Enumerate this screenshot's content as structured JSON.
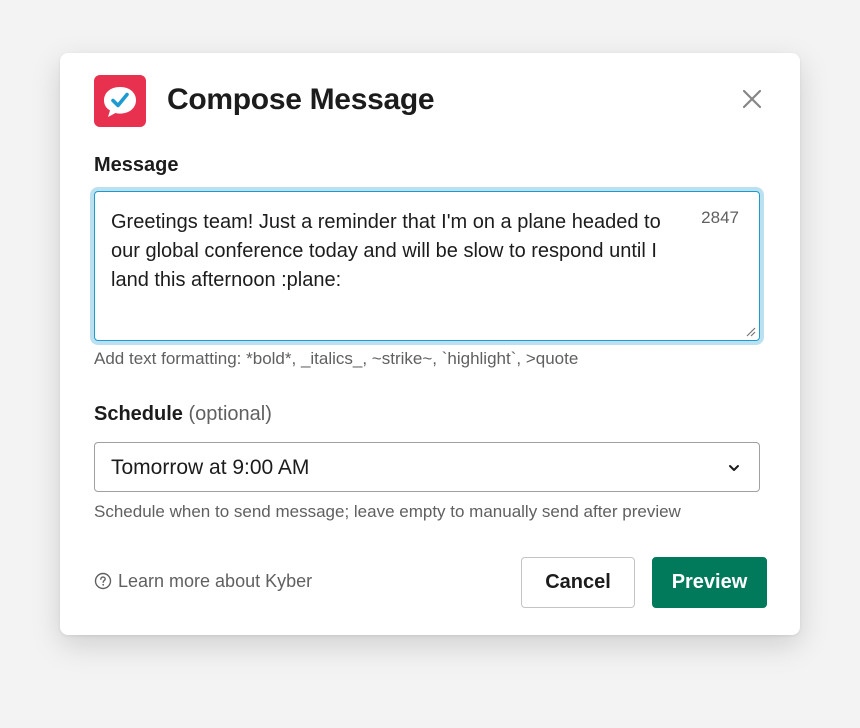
{
  "dialog": {
    "title": "Compose Message",
    "close_icon": "close-icon",
    "app_icon": "kyber-logo-icon"
  },
  "colors": {
    "app_icon_bg": "#e8314f",
    "focus_border": "#1d9bd1",
    "primary_button": "#007a5a"
  },
  "message": {
    "label": "Message",
    "value": "Greetings team! Just a reminder that I'm on a plane headed to our global conference today and will be slow to respond until I land this afternoon :plane:",
    "char_count": "2847",
    "hint": "Add text formatting: *bold*, _italics_, ~strike~, `highlight`, >quote"
  },
  "schedule": {
    "label": "Schedule",
    "optional": "(optional)",
    "selected": "Tomorrow at 9:00 AM",
    "hint": "Schedule when to send message; leave empty to manually send after preview"
  },
  "footer": {
    "learn_more": "Learn more about Kyber",
    "cancel_label": "Cancel",
    "preview_label": "Preview"
  }
}
